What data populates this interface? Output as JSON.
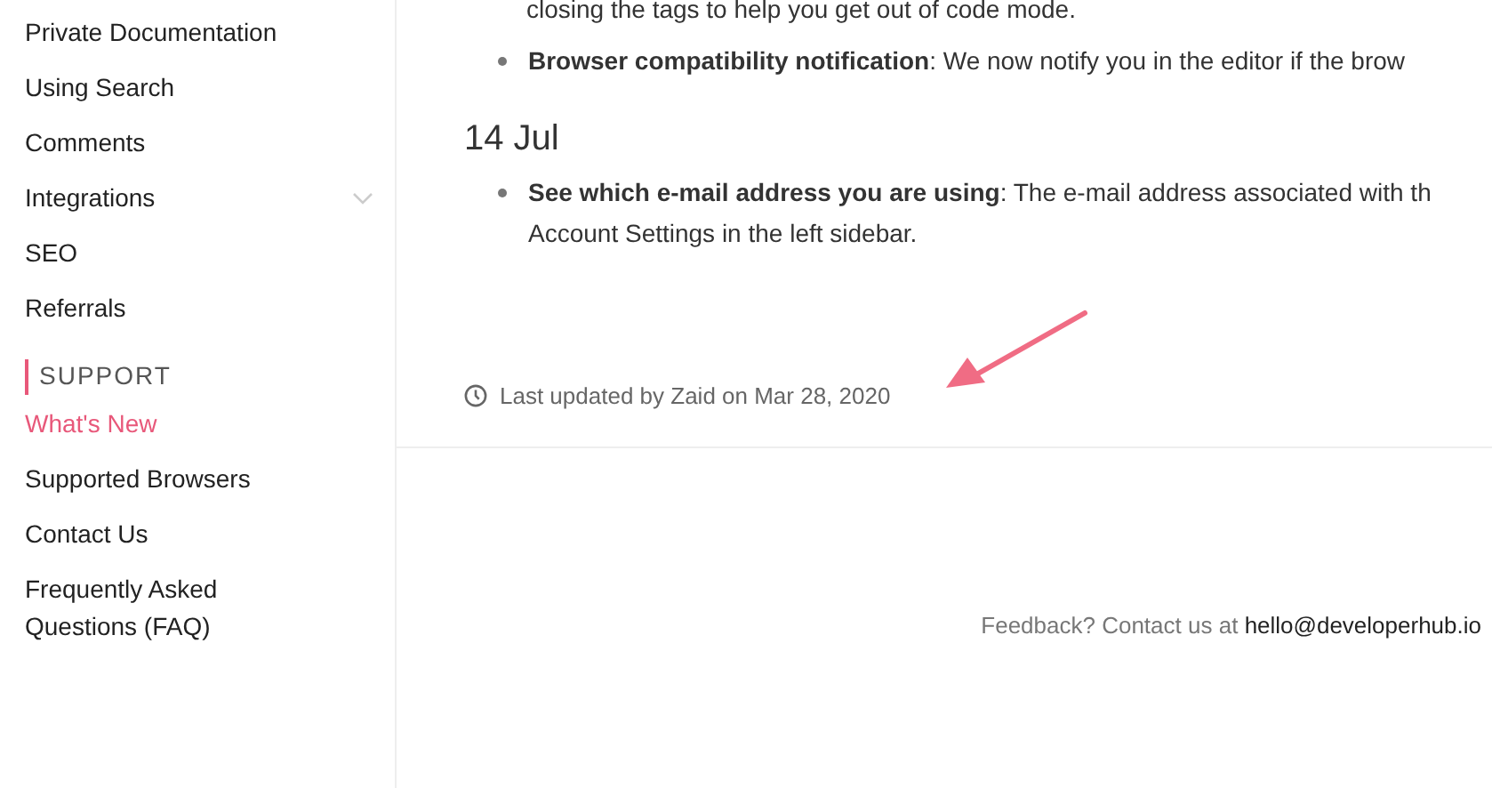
{
  "sidebar": {
    "items": [
      {
        "label": "Private Documentation",
        "kind": "link",
        "selected": false
      },
      {
        "label": "Using Search",
        "kind": "link",
        "selected": false
      },
      {
        "label": "Comments",
        "kind": "link",
        "selected": false
      },
      {
        "label": "Integrations",
        "kind": "expandable",
        "selected": false
      },
      {
        "label": "SEO",
        "kind": "link",
        "selected": false
      },
      {
        "label": "Referrals",
        "kind": "link",
        "selected": false
      }
    ],
    "section": {
      "title": "SUPPORT",
      "items": [
        {
          "label": "What's New",
          "kind": "link",
          "selected": true
        },
        {
          "label": "Supported Browsers",
          "kind": "link",
          "selected": false
        },
        {
          "label": "Contact Us",
          "kind": "link",
          "selected": false
        },
        {
          "label": "Frequently Asked Questions (FAQ)",
          "kind": "link",
          "selected": false
        }
      ]
    }
  },
  "content": {
    "blocks": [
      {
        "kind": "continuation",
        "lines": [
          "closing the tags to help you get out of code mode."
        ]
      },
      {
        "kind": "bullet",
        "lines": [
          "**Browser compatibility notification**: We now notify you in the editor if the brow"
        ]
      },
      {
        "kind": "date",
        "lines": [
          "14 Jul"
        ]
      },
      {
        "kind": "bullet",
        "lines": [
          "**See which e-mail address you are using**: The e-mail address associated with th",
          "Account Settings in the left sidebar."
        ]
      }
    ],
    "last_updated": "Last updated by Zaid on Mar 28, 2020"
  },
  "footer": {
    "text": "Feedback? Contact us at",
    "link": "hello@developerhub.io"
  }
}
